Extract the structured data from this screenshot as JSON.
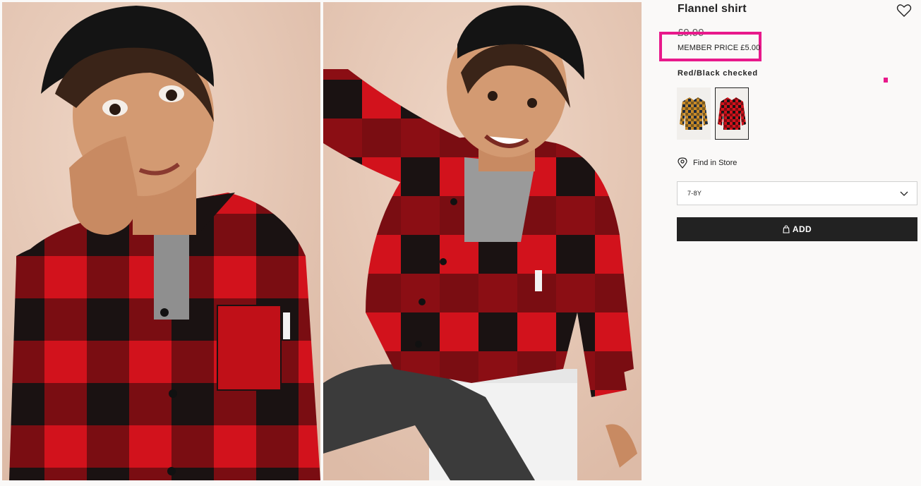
{
  "product": {
    "title": "Flannel shirt",
    "old_price": "£9.99",
    "member_price": "MEMBER PRICE £5.00",
    "color_name": "Red/Black checked",
    "find_in_store": "Find in Store",
    "size_selected": "7-8Y",
    "add_label": "ADD"
  },
  "swatches": [
    {
      "name": "mustard-navy-check",
      "color_a": "#c78a2a",
      "color_b": "#1f2a3c"
    },
    {
      "name": "red-black-check",
      "color_a": "#d2121c",
      "color_b": "#1a1212"
    }
  ],
  "icons": {
    "favorite": "heart-icon",
    "store": "location-pin-icon",
    "dropdown": "chevron-down-icon",
    "add": "shopping-bag-icon"
  },
  "colors": {
    "highlight": "#e8198b",
    "button_bg": "#222222",
    "background": "#faf9f8",
    "plaid_red": "#d2121c",
    "plaid_black": "#1a1212"
  }
}
